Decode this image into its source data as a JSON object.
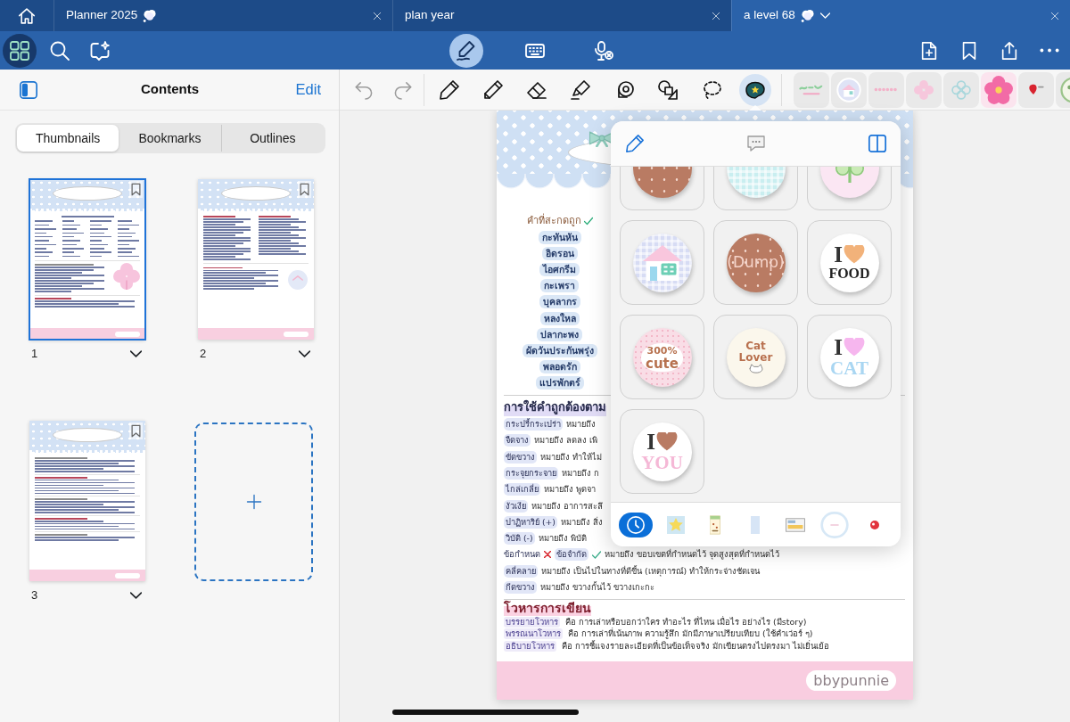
{
  "tabs": [
    {
      "title": "Planner 2025",
      "thought_icon": true,
      "selected": false
    },
    {
      "title": "plan year",
      "thought_icon": false,
      "selected": false
    },
    {
      "title": "a level 68",
      "thought_icon": true,
      "selected": true
    }
  ],
  "toolbar": {
    "left": [
      {
        "kind": "grid",
        "selected": true
      },
      {
        "kind": "search",
        "selected": false
      },
      {
        "kind": "assistant",
        "selected": false
      }
    ],
    "modes": [
      {
        "kind": "write",
        "selected": true
      },
      {
        "kind": "keyboard",
        "selected": false
      },
      {
        "kind": "voice",
        "selected": false
      }
    ]
  },
  "sidebar": {
    "title": "Contents",
    "action": "Edit",
    "segments": [
      {
        "label": "Thumbnails",
        "selected": true
      },
      {
        "label": "Bookmarks",
        "selected": false
      },
      {
        "label": "Outlines",
        "selected": false
      }
    ],
    "pages": [
      {
        "number": "1",
        "kind": "words",
        "selected": true
      },
      {
        "number": "2",
        "kind": "columns",
        "selected": false
      },
      {
        "number": "3",
        "kind": "notes",
        "selected": false
      }
    ]
  },
  "tools": {
    "history": [
      {
        "kind": "undo",
        "disabled": true
      },
      {
        "kind": "redo",
        "disabled": true
      }
    ],
    "items": [
      {
        "kind": "pen",
        "selected": false
      },
      {
        "kind": "pencil",
        "selected": false
      },
      {
        "kind": "eraser",
        "selected": false
      },
      {
        "kind": "highlighter",
        "selected": false
      },
      {
        "kind": "tape",
        "selected": false
      },
      {
        "kind": "shapes",
        "selected": false
      },
      {
        "kind": "lasso",
        "selected": false
      },
      {
        "kind": "sticker",
        "selected": true
      }
    ]
  },
  "page": {
    "word_list": {
      "heading": "คำที่สะกดถูก",
      "words": [
        "กะทันหัน",
        "อิดรอน",
        "ไอศกรีม",
        "กะเพรา",
        "บุคลากร",
        "หลงใหล",
        "ปลากะพง",
        "ผัดวันประกันพรุ่ง",
        "พลอดรัก",
        "แปรพักตร์"
      ]
    },
    "usage": {
      "heading": "การใช้คำถูกต้องตาม",
      "entries": [
        {
          "kind": "term",
          "term": "กระปรี้กระเปร่า",
          "text": "หมายถึง"
        },
        {
          "kind": "term",
          "term": "จืดจาง",
          "text": "หมายถึง ลดลง เพิ"
        },
        {
          "kind": "term",
          "term": "ขัดขวาง",
          "text": "หมายถึง ทำให้ไม่"
        },
        {
          "kind": "term",
          "term": "กระจุยกระจาย",
          "text": "หมายถึง ก"
        },
        {
          "kind": "term",
          "term": "ไกล่เกลี่ย",
          "text": "หมายถึง พูดจา"
        },
        {
          "kind": "term",
          "term": "งัวเงีย",
          "text": "หมายถึง อาการสะลึ"
        },
        {
          "kind": "term",
          "term": "ปาฏิหาริย์ (+)",
          "text": "หมายถึง สิ่ง"
        },
        {
          "kind": "term",
          "term": "วิบัติ (-)",
          "text": "หมายถึง พิบัติ"
        },
        {
          "kind": "compare",
          "term": "ข้อกำหนด",
          "right": "ข้อจำกัด",
          "text": "หมายถึง ขอบเขตที่กำหนดไว้ จุดสูงสุดที่กำหนดไว้"
        },
        {
          "kind": "term",
          "term": "คลี่คลาย",
          "text": "หมายถึง เป็นไปในทางที่ดีขึ้น (เหตุการณ์) ทำให้กระจ่างชัดเจน"
        },
        {
          "kind": "term",
          "term": "กีดขวาง",
          "text": "หมายถึง ขวางกั้นไว้ ขวางเกะกะ"
        }
      ]
    },
    "writing_styles": {
      "heading": "โวหารการเขียน",
      "entries": [
        {
          "term": "บรรยายโวหาร",
          "text": "คือ การเล่าหรือบอกว่าใคร ทำอะไร ที่ไหน เมื่อไร อย่างไร (มีstory)"
        },
        {
          "term": "พรรณนาโวหาร",
          "text": "คือ การเล่าที่เน้นภาพ ความรู้สึก มักมีภาษาเปรียบเทียบ (ใช้คำเว่อร์ ๆ)"
        },
        {
          "term": "อธิบายโวหาร",
          "text": "คือ การชี้แจงรายละเอียดที่เป็นข้อเท็จจริง มักเขียนตรงไปตรงมา ไม่เยิ่นเย้อ"
        }
      ]
    },
    "footer": "bbypunnie"
  },
  "sticker_panel": {
    "stickers": [
      {
        "kind": "dots",
        "color": "#b97b63"
      },
      {
        "kind": "gingham",
        "color": "#c9eef0"
      },
      {
        "kind": "clover",
        "color": "#fbe6f3"
      },
      {
        "kind": "house",
        "color": "#d7dcf4"
      },
      {
        "kind": "dots",
        "color": "#b97b63",
        "lines": [
          "(Dump)"
        ]
      },
      {
        "kind": "love",
        "color": "#f2b27a",
        "top": "I",
        "word": {
          "text": "FOOD",
          "color": "#222222"
        }
      },
      {
        "kind": "cute",
        "color": "#f9dde6",
        "lines": [
          "300%",
          "cute"
        ]
      },
      {
        "kind": "cat",
        "color": "#fbf7ec",
        "lines": [
          "Cat",
          "Lover"
        ]
      },
      {
        "kind": "love",
        "color": "#f6b6ee",
        "top": "I",
        "word": {
          "text": "CAT",
          "color": "#a9d6f2"
        }
      },
      {
        "kind": "love",
        "color": "#b97b63",
        "top": "I",
        "word": {
          "text": "YOU",
          "color": "#f5b8d6"
        }
      }
    ],
    "categories": [
      {
        "kind": "recent",
        "selected": true
      },
      {
        "kind": "star",
        "selected": false
      },
      {
        "kind": "note",
        "selected": false
      },
      {
        "kind": "card",
        "selected": false
      },
      {
        "kind": "photo",
        "selected": false
      },
      {
        "kind": "frame",
        "selected": false
      },
      {
        "kind": "dot",
        "selected": false
      }
    ]
  }
}
